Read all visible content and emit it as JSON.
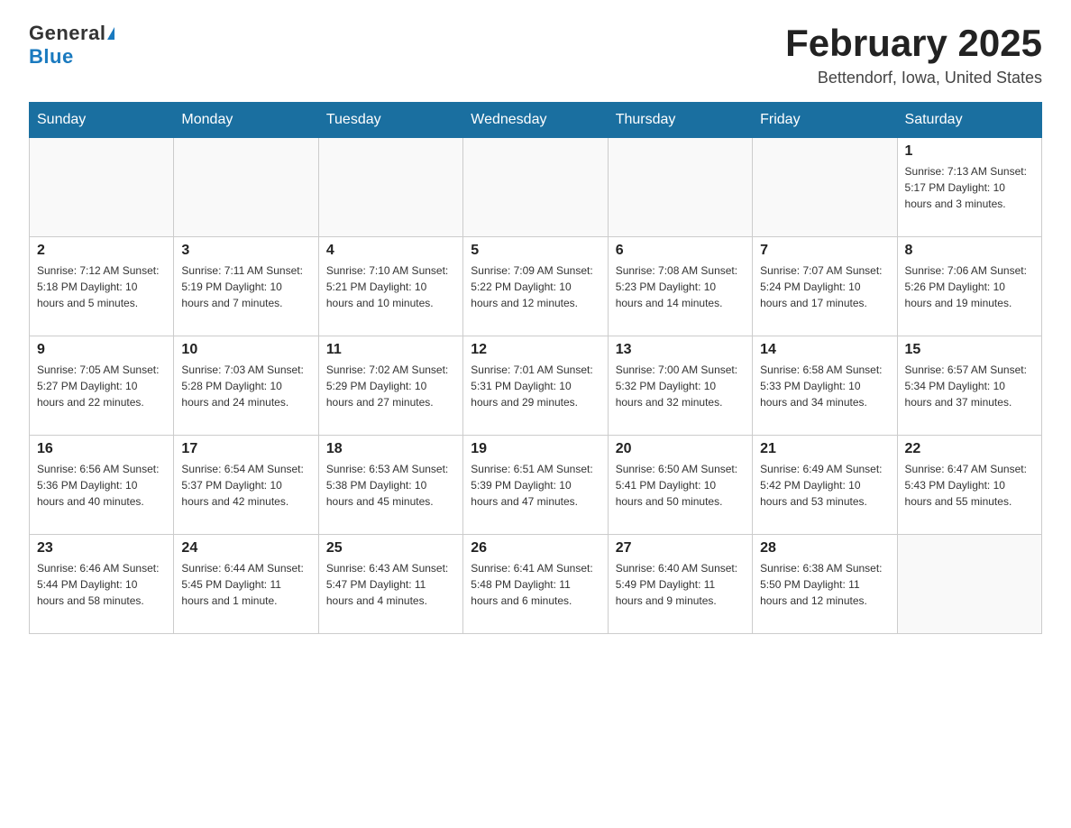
{
  "logo": {
    "general": "General",
    "blue": "Blue"
  },
  "title": "February 2025",
  "location": "Bettendorf, Iowa, United States",
  "days_of_week": [
    "Sunday",
    "Monday",
    "Tuesday",
    "Wednesday",
    "Thursday",
    "Friday",
    "Saturday"
  ],
  "weeks": [
    [
      {
        "day": "",
        "info": ""
      },
      {
        "day": "",
        "info": ""
      },
      {
        "day": "",
        "info": ""
      },
      {
        "day": "",
        "info": ""
      },
      {
        "day": "",
        "info": ""
      },
      {
        "day": "",
        "info": ""
      },
      {
        "day": "1",
        "info": "Sunrise: 7:13 AM\nSunset: 5:17 PM\nDaylight: 10 hours and 3 minutes."
      }
    ],
    [
      {
        "day": "2",
        "info": "Sunrise: 7:12 AM\nSunset: 5:18 PM\nDaylight: 10 hours and 5 minutes."
      },
      {
        "day": "3",
        "info": "Sunrise: 7:11 AM\nSunset: 5:19 PM\nDaylight: 10 hours and 7 minutes."
      },
      {
        "day": "4",
        "info": "Sunrise: 7:10 AM\nSunset: 5:21 PM\nDaylight: 10 hours and 10 minutes."
      },
      {
        "day": "5",
        "info": "Sunrise: 7:09 AM\nSunset: 5:22 PM\nDaylight: 10 hours and 12 minutes."
      },
      {
        "day": "6",
        "info": "Sunrise: 7:08 AM\nSunset: 5:23 PM\nDaylight: 10 hours and 14 minutes."
      },
      {
        "day": "7",
        "info": "Sunrise: 7:07 AM\nSunset: 5:24 PM\nDaylight: 10 hours and 17 minutes."
      },
      {
        "day": "8",
        "info": "Sunrise: 7:06 AM\nSunset: 5:26 PM\nDaylight: 10 hours and 19 minutes."
      }
    ],
    [
      {
        "day": "9",
        "info": "Sunrise: 7:05 AM\nSunset: 5:27 PM\nDaylight: 10 hours and 22 minutes."
      },
      {
        "day": "10",
        "info": "Sunrise: 7:03 AM\nSunset: 5:28 PM\nDaylight: 10 hours and 24 minutes."
      },
      {
        "day": "11",
        "info": "Sunrise: 7:02 AM\nSunset: 5:29 PM\nDaylight: 10 hours and 27 minutes."
      },
      {
        "day": "12",
        "info": "Sunrise: 7:01 AM\nSunset: 5:31 PM\nDaylight: 10 hours and 29 minutes."
      },
      {
        "day": "13",
        "info": "Sunrise: 7:00 AM\nSunset: 5:32 PM\nDaylight: 10 hours and 32 minutes."
      },
      {
        "day": "14",
        "info": "Sunrise: 6:58 AM\nSunset: 5:33 PM\nDaylight: 10 hours and 34 minutes."
      },
      {
        "day": "15",
        "info": "Sunrise: 6:57 AM\nSunset: 5:34 PM\nDaylight: 10 hours and 37 minutes."
      }
    ],
    [
      {
        "day": "16",
        "info": "Sunrise: 6:56 AM\nSunset: 5:36 PM\nDaylight: 10 hours and 40 minutes."
      },
      {
        "day": "17",
        "info": "Sunrise: 6:54 AM\nSunset: 5:37 PM\nDaylight: 10 hours and 42 minutes."
      },
      {
        "day": "18",
        "info": "Sunrise: 6:53 AM\nSunset: 5:38 PM\nDaylight: 10 hours and 45 minutes."
      },
      {
        "day": "19",
        "info": "Sunrise: 6:51 AM\nSunset: 5:39 PM\nDaylight: 10 hours and 47 minutes."
      },
      {
        "day": "20",
        "info": "Sunrise: 6:50 AM\nSunset: 5:41 PM\nDaylight: 10 hours and 50 minutes."
      },
      {
        "day": "21",
        "info": "Sunrise: 6:49 AM\nSunset: 5:42 PM\nDaylight: 10 hours and 53 minutes."
      },
      {
        "day": "22",
        "info": "Sunrise: 6:47 AM\nSunset: 5:43 PM\nDaylight: 10 hours and 55 minutes."
      }
    ],
    [
      {
        "day": "23",
        "info": "Sunrise: 6:46 AM\nSunset: 5:44 PM\nDaylight: 10 hours and 58 minutes."
      },
      {
        "day": "24",
        "info": "Sunrise: 6:44 AM\nSunset: 5:45 PM\nDaylight: 11 hours and 1 minute."
      },
      {
        "day": "25",
        "info": "Sunrise: 6:43 AM\nSunset: 5:47 PM\nDaylight: 11 hours and 4 minutes."
      },
      {
        "day": "26",
        "info": "Sunrise: 6:41 AM\nSunset: 5:48 PM\nDaylight: 11 hours and 6 minutes."
      },
      {
        "day": "27",
        "info": "Sunrise: 6:40 AM\nSunset: 5:49 PM\nDaylight: 11 hours and 9 minutes."
      },
      {
        "day": "28",
        "info": "Sunrise: 6:38 AM\nSunset: 5:50 PM\nDaylight: 11 hours and 12 minutes."
      },
      {
        "day": "",
        "info": ""
      }
    ]
  ]
}
